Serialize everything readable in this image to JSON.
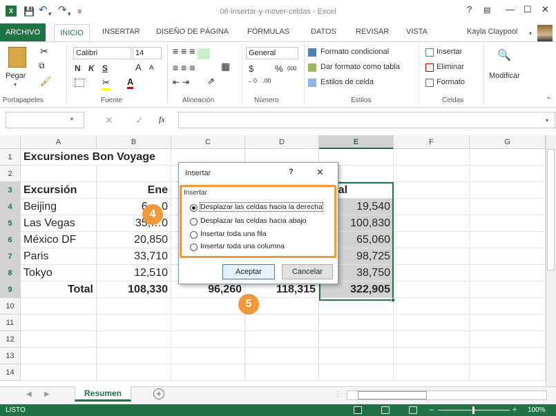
{
  "window": {
    "title": "06-insertar-y-mover-celdas - Excel",
    "help": "?",
    "restore_icon": "ribbon-display-icon",
    "min": "—",
    "max": "☐",
    "close": "✕"
  },
  "quick_access": {
    "app_badge": "X",
    "save_icon": "save-icon",
    "undo_icon": "undo-icon",
    "redo_icon": "redo-icon"
  },
  "tabs": [
    "ARCHIVO",
    "INICIO",
    "INSERTAR",
    "DISEÑO DE PÁGINA",
    "FÓRMULAS",
    "DATOS",
    "REVISAR",
    "VISTA"
  ],
  "user": {
    "name": "Kayla Claypool"
  },
  "ribbon": {
    "paste": "Pegar",
    "font_name": "Calibri",
    "font_size": "14",
    "bold": "N",
    "italic": "K",
    "underline": "S",
    "grow_font": "A",
    "shrink_font": "A",
    "number_format": "General",
    "currency": "$",
    "percent": "%",
    "thousands": "000",
    "dec_inc": "←0\n.00",
    "dec_dec": ".00\n→0",
    "conditional_format": "Formato condicional",
    "format_table": "Dar formato como tabla",
    "cell_styles": "Estilos de celda",
    "insert": "Insertar",
    "delete": "Eliminar",
    "format": "Formato",
    "modify": "Modificar",
    "groups": [
      "Portapapeles",
      "Fuente",
      "Alineación",
      "Número",
      "Estilos",
      "Celdas"
    ]
  },
  "formula_bar": {
    "fx": "fx",
    "value": ""
  },
  "columns": [
    "A",
    "B",
    "C",
    "D",
    "E",
    "F",
    "G"
  ],
  "rows": [
    {
      "n": "1",
      "A": "Excursiones Bon Voyage",
      "B": "",
      "C": "",
      "D": "",
      "E": ""
    },
    {
      "n": "2",
      "A": "",
      "B": "",
      "C": "",
      "D": "",
      "E": ""
    },
    {
      "n": "3",
      "A": "Excursión",
      "B": "Ene",
      "C": "",
      "D": "",
      "E": "Total"
    },
    {
      "n": "4",
      "A": "Beijing",
      "B": "6,…0",
      "C": "",
      "D": "",
      "E": "19,540"
    },
    {
      "n": "5",
      "A": "Las Vegas",
      "B": "35,…0",
      "C": "",
      "D": "",
      "E": "100,830"
    },
    {
      "n": "6",
      "A": "México DF",
      "B": "20,850",
      "C": "",
      "D": "",
      "E": "65,060"
    },
    {
      "n": "7",
      "A": "Paris",
      "B": "33,710",
      "C": "",
      "D": "",
      "E": "98,725"
    },
    {
      "n": "8",
      "A": "Tokyo",
      "B": "12,510",
      "C": "",
      "D": "",
      "E": "38,750"
    },
    {
      "n": "9",
      "A": "Total",
      "B": "108,330",
      "C": "96,260",
      "D": "118,315",
      "E": "322,905"
    },
    {
      "n": "10"
    },
    {
      "n": "11"
    },
    {
      "n": "12"
    },
    {
      "n": "13"
    },
    {
      "n": "14"
    }
  ],
  "dialog": {
    "title": "Insertar",
    "help": "?",
    "close": "✕",
    "group_label": "Insertar",
    "options": [
      "Desplazar las celdas hacia la derecha",
      "Desplazar las celdas hacia abajo",
      "Insertar toda una fila",
      "Insertar toda una columna"
    ],
    "selected_index": 0,
    "ok": "Aceptar",
    "cancel": "Cancelar"
  },
  "callouts": {
    "step4": "4",
    "step5": "5"
  },
  "sheet_tab": "Resumen",
  "status": {
    "mode": "LISTO",
    "zoom": "100%"
  },
  "colors": {
    "accent": "#217346",
    "callout": "#f0983a"
  }
}
